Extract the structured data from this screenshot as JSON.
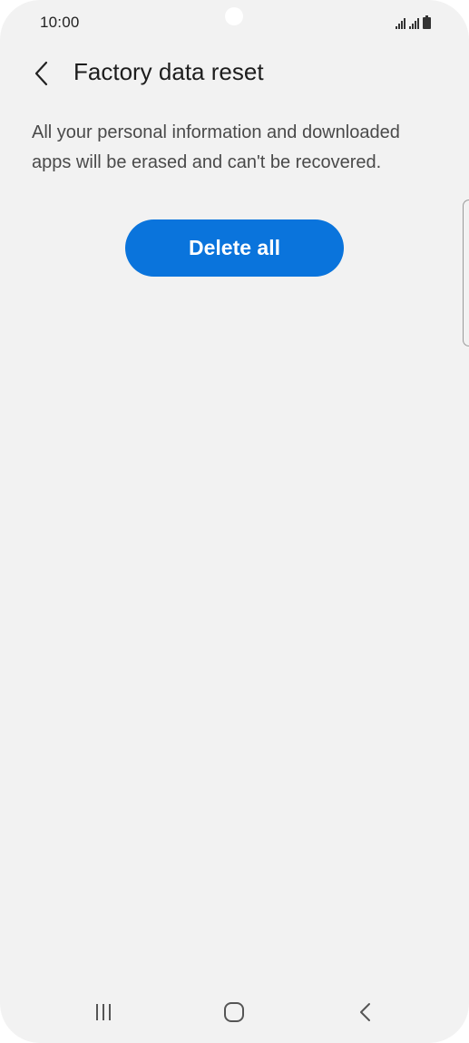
{
  "status_bar": {
    "time": "10:00"
  },
  "header": {
    "back_icon": "chevron-left-icon",
    "title": "Factory data reset"
  },
  "main": {
    "description": "All your personal information and downloaded apps will be erased and can't be recovered.",
    "delete_button_label": "Delete all"
  },
  "nav_bar": {
    "recents_icon": "recents-icon",
    "home_icon": "home-icon",
    "back_icon": "back-icon"
  },
  "colors": {
    "accent": "#0a74dc",
    "background": "#f2f2f2"
  }
}
